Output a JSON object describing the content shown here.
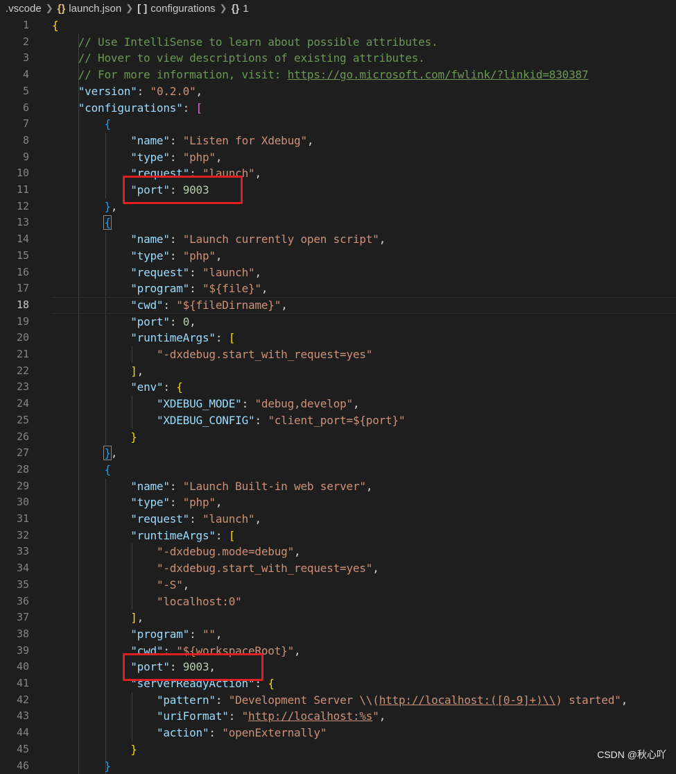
{
  "breadcrumb": {
    "items": [
      {
        "icon": "",
        "label": ".vscode"
      },
      {
        "icon": "{}",
        "label": "launch.json"
      },
      {
        "icon": "[ ]",
        "label": "configurations"
      },
      {
        "icon": "{}",
        "label": "1"
      }
    ]
  },
  "editor": {
    "active_line": 18,
    "lines": [
      {
        "n": 1,
        "t": [
          [
            "b1",
            "{"
          ]
        ]
      },
      {
        "n": 2,
        "t": [
          [
            "c",
            "    // Use IntelliSense to learn about possible attributes."
          ]
        ]
      },
      {
        "n": 3,
        "t": [
          [
            "c",
            "    // Hover to view descriptions of existing attributes."
          ]
        ]
      },
      {
        "n": 4,
        "t": [
          [
            "c",
            "    // For more information, visit: "
          ],
          [
            "cu",
            "https://go.microsoft.com/fwlink/?linkid=830387"
          ]
        ]
      },
      {
        "n": 5,
        "t": [
          [
            "p",
            "    "
          ],
          [
            "k",
            "\"version\""
          ],
          [
            "p",
            ": "
          ],
          [
            "s",
            "\"0.2.0\""
          ],
          [
            "p",
            ","
          ]
        ]
      },
      {
        "n": 6,
        "t": [
          [
            "p",
            "    "
          ],
          [
            "k",
            "\"configurations\""
          ],
          [
            "p",
            ": "
          ],
          [
            "b2",
            "["
          ]
        ]
      },
      {
        "n": 7,
        "t": [
          [
            "p",
            "        "
          ],
          [
            "b3",
            "{"
          ]
        ]
      },
      {
        "n": 8,
        "t": [
          [
            "p",
            "            "
          ],
          [
            "k",
            "\"name\""
          ],
          [
            "p",
            ": "
          ],
          [
            "s",
            "\"Listen for Xdebug\""
          ],
          [
            "p",
            ","
          ]
        ]
      },
      {
        "n": 9,
        "t": [
          [
            "p",
            "            "
          ],
          [
            "k",
            "\"type\""
          ],
          [
            "p",
            ": "
          ],
          [
            "s",
            "\"php\""
          ],
          [
            "p",
            ","
          ]
        ]
      },
      {
        "n": 10,
        "t": [
          [
            "p",
            "            "
          ],
          [
            "k",
            "\"request\""
          ],
          [
            "p",
            ": "
          ],
          [
            "s",
            "\"launch\""
          ],
          [
            "p",
            ","
          ]
        ]
      },
      {
        "n": 11,
        "t": [
          [
            "p",
            "            "
          ],
          [
            "k",
            "\"port\""
          ],
          [
            "p",
            ": "
          ],
          [
            "n",
            "9003"
          ]
        ]
      },
      {
        "n": 12,
        "t": [
          [
            "p",
            "        "
          ],
          [
            "b3",
            "}"
          ],
          [
            "p",
            ","
          ]
        ]
      },
      {
        "n": 13,
        "t": [
          [
            "p",
            "        "
          ],
          [
            "b3 bm",
            "{"
          ]
        ]
      },
      {
        "n": 14,
        "t": [
          [
            "p",
            "            "
          ],
          [
            "k",
            "\"name\""
          ],
          [
            "p",
            ": "
          ],
          [
            "s",
            "\"Launch currently open script\""
          ],
          [
            "p",
            ","
          ]
        ]
      },
      {
        "n": 15,
        "t": [
          [
            "p",
            "            "
          ],
          [
            "k",
            "\"type\""
          ],
          [
            "p",
            ": "
          ],
          [
            "s",
            "\"php\""
          ],
          [
            "p",
            ","
          ]
        ]
      },
      {
        "n": 16,
        "t": [
          [
            "p",
            "            "
          ],
          [
            "k",
            "\"request\""
          ],
          [
            "p",
            ": "
          ],
          [
            "s",
            "\"launch\""
          ],
          [
            "p",
            ","
          ]
        ]
      },
      {
        "n": 17,
        "t": [
          [
            "p",
            "            "
          ],
          [
            "k",
            "\"program\""
          ],
          [
            "p",
            ": "
          ],
          [
            "s",
            "\"${file}\""
          ],
          [
            "p",
            ","
          ]
        ]
      },
      {
        "n": 18,
        "t": [
          [
            "p",
            "            "
          ],
          [
            "k",
            "\"cwd\""
          ],
          [
            "p",
            ": "
          ],
          [
            "s",
            "\"${fileDirname}\""
          ],
          [
            "p",
            ","
          ]
        ]
      },
      {
        "n": 19,
        "t": [
          [
            "p",
            "            "
          ],
          [
            "k",
            "\"port\""
          ],
          [
            "p",
            ": "
          ],
          [
            "n",
            "0"
          ],
          [
            "p",
            ","
          ]
        ]
      },
      {
        "n": 20,
        "t": [
          [
            "p",
            "            "
          ],
          [
            "k",
            "\"runtimeArgs\""
          ],
          [
            "p",
            ": "
          ],
          [
            "b1",
            "["
          ]
        ]
      },
      {
        "n": 21,
        "t": [
          [
            "p",
            "                "
          ],
          [
            "s",
            "\"-dxdebug.start_with_request=yes\""
          ]
        ]
      },
      {
        "n": 22,
        "t": [
          [
            "p",
            "            "
          ],
          [
            "b1",
            "]"
          ],
          [
            "p",
            ","
          ]
        ]
      },
      {
        "n": 23,
        "t": [
          [
            "p",
            "            "
          ],
          [
            "k",
            "\"env\""
          ],
          [
            "p",
            ": "
          ],
          [
            "b1",
            "{"
          ]
        ]
      },
      {
        "n": 24,
        "t": [
          [
            "p",
            "                "
          ],
          [
            "k",
            "\"XDEBUG_MODE\""
          ],
          [
            "p",
            ": "
          ],
          [
            "s",
            "\"debug,develop\""
          ],
          [
            "p",
            ","
          ]
        ]
      },
      {
        "n": 25,
        "t": [
          [
            "p",
            "                "
          ],
          [
            "k",
            "\"XDEBUG_CONFIG\""
          ],
          [
            "p",
            ": "
          ],
          [
            "s",
            "\"client_port=${port}\""
          ]
        ]
      },
      {
        "n": 26,
        "t": [
          [
            "p",
            "            "
          ],
          [
            "b1",
            "}"
          ]
        ]
      },
      {
        "n": 27,
        "t": [
          [
            "p",
            "        "
          ],
          [
            "b3 bm",
            "}"
          ],
          [
            "p",
            ","
          ]
        ]
      },
      {
        "n": 28,
        "t": [
          [
            "p",
            "        "
          ],
          [
            "b3",
            "{"
          ]
        ]
      },
      {
        "n": 29,
        "t": [
          [
            "p",
            "            "
          ],
          [
            "k",
            "\"name\""
          ],
          [
            "p",
            ": "
          ],
          [
            "s",
            "\"Launch Built-in web server\""
          ],
          [
            "p",
            ","
          ]
        ]
      },
      {
        "n": 30,
        "t": [
          [
            "p",
            "            "
          ],
          [
            "k",
            "\"type\""
          ],
          [
            "p",
            ": "
          ],
          [
            "s",
            "\"php\""
          ],
          [
            "p",
            ","
          ]
        ]
      },
      {
        "n": 31,
        "t": [
          [
            "p",
            "            "
          ],
          [
            "k",
            "\"request\""
          ],
          [
            "p",
            ": "
          ],
          [
            "s",
            "\"launch\""
          ],
          [
            "p",
            ","
          ]
        ]
      },
      {
        "n": 32,
        "t": [
          [
            "p",
            "            "
          ],
          [
            "k",
            "\"runtimeArgs\""
          ],
          [
            "p",
            ": "
          ],
          [
            "b1",
            "["
          ]
        ]
      },
      {
        "n": 33,
        "t": [
          [
            "p",
            "                "
          ],
          [
            "s",
            "\"-dxdebug.mode=debug\""
          ],
          [
            "p",
            ","
          ]
        ]
      },
      {
        "n": 34,
        "t": [
          [
            "p",
            "                "
          ],
          [
            "s",
            "\"-dxdebug.start_with_request=yes\""
          ],
          [
            "p",
            ","
          ]
        ]
      },
      {
        "n": 35,
        "t": [
          [
            "p",
            "                "
          ],
          [
            "s",
            "\"-S\""
          ],
          [
            "p",
            ","
          ]
        ]
      },
      {
        "n": 36,
        "t": [
          [
            "p",
            "                "
          ],
          [
            "s",
            "\"localhost:0\""
          ]
        ]
      },
      {
        "n": 37,
        "t": [
          [
            "p",
            "            "
          ],
          [
            "b1",
            "]"
          ],
          [
            "p",
            ","
          ]
        ]
      },
      {
        "n": 38,
        "t": [
          [
            "p",
            "            "
          ],
          [
            "k",
            "\"program\""
          ],
          [
            "p",
            ": "
          ],
          [
            "s",
            "\"\""
          ],
          [
            "p",
            ","
          ]
        ]
      },
      {
        "n": 39,
        "t": [
          [
            "p",
            "            "
          ],
          [
            "k",
            "\"cwd\""
          ],
          [
            "p",
            ": "
          ],
          [
            "s",
            "\"${workspaceRoot}\""
          ],
          [
            "p",
            ","
          ]
        ]
      },
      {
        "n": 40,
        "t": [
          [
            "p",
            "            "
          ],
          [
            "k",
            "\"port\""
          ],
          [
            "p",
            ": "
          ],
          [
            "n",
            "9003"
          ],
          [
            "p",
            ","
          ]
        ]
      },
      {
        "n": 41,
        "t": [
          [
            "p",
            "            "
          ],
          [
            "k",
            "\"serverReadyAction\""
          ],
          [
            "p",
            ": "
          ],
          [
            "b1",
            "{"
          ]
        ]
      },
      {
        "n": 42,
        "t": [
          [
            "p",
            "                "
          ],
          [
            "k",
            "\"pattern\""
          ],
          [
            "p",
            ": "
          ],
          [
            "s",
            "\"Development Server \\\\("
          ],
          [
            "u",
            "http://localhost:([0-9]+)\\\\"
          ],
          [
            "s",
            ") started\""
          ],
          [
            "p",
            ","
          ]
        ]
      },
      {
        "n": 43,
        "t": [
          [
            "p",
            "                "
          ],
          [
            "k",
            "\"uriFormat\""
          ],
          [
            "p",
            ": "
          ],
          [
            "s",
            "\""
          ],
          [
            "u",
            "http://localhost:%s"
          ],
          [
            "s",
            "\""
          ],
          [
            "p",
            ","
          ]
        ]
      },
      {
        "n": 44,
        "t": [
          [
            "p",
            "                "
          ],
          [
            "k",
            "\"action\""
          ],
          [
            "p",
            ": "
          ],
          [
            "s",
            "\"openExternally\""
          ]
        ]
      },
      {
        "n": 45,
        "t": [
          [
            "p",
            "            "
          ],
          [
            "b1",
            "}"
          ]
        ]
      },
      {
        "n": 46,
        "t": [
          [
            "p",
            "        "
          ],
          [
            "b3",
            "}"
          ]
        ]
      }
    ]
  },
  "watermark": "CSDN @秋心吖",
  "colors": {
    "background": "#1e1e1e",
    "key": "#9cdcfe",
    "string": "#ce9178",
    "number": "#b5cea8",
    "comment": "#6a9955",
    "highlight_box": "#e02020"
  }
}
